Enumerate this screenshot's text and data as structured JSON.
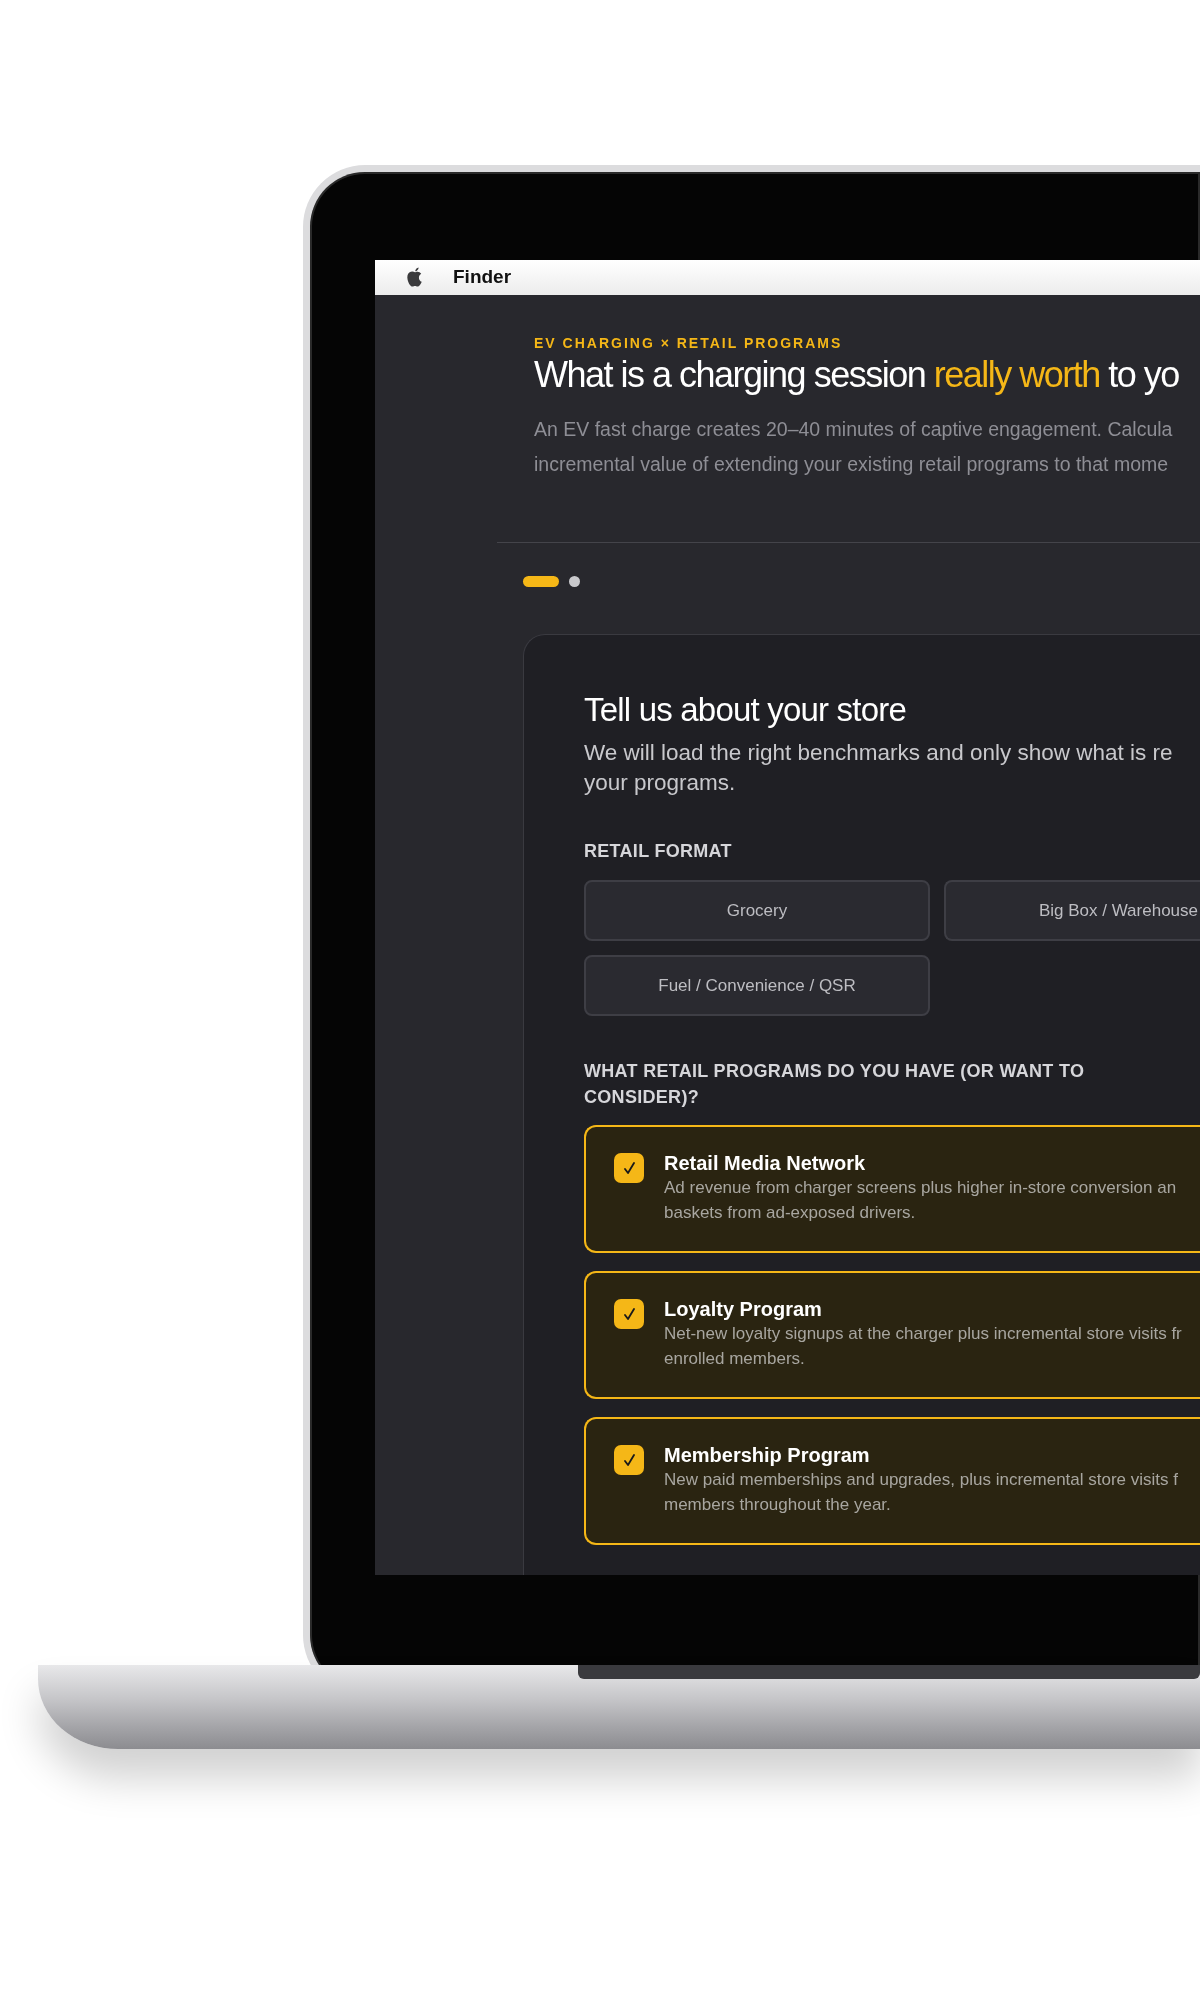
{
  "menu_bar": {
    "app_name": "Finder"
  },
  "hero": {
    "eyebrow": "EV CHARGING × RETAIL PROGRAMS",
    "heading": [
      {
        "text": "What is a charging session ",
        "highlight": false
      },
      {
        "text": "really worth",
        "highlight": true
      },
      {
        "text": " to yo",
        "highlight": false
      }
    ],
    "intro_lines": [
      "An EV fast charge creates 20–40 minutes of captive engagement. Calcula",
      "incremental value of extending your existing retail programs to that mome"
    ]
  },
  "steps": [
    {
      "selected": true
    },
    {
      "selected": false
    }
  ],
  "store_card": {
    "title": "Tell us about your store",
    "subtitle_lines": [
      "We will load the right benchmarks and only show what is re",
      "your programs."
    ],
    "format_label": "RETAIL FORMAT",
    "formats": [
      {
        "label": "Grocery",
        "selected": false
      },
      {
        "label": "Big Box / Warehouse",
        "selected": false
      },
      {
        "label": "Fuel / Convenience / QSR",
        "selected": false
      }
    ],
    "programs_label": "WHAT RETAIL PROGRAMS DO YOU HAVE (OR WANT TO CONSIDER)?",
    "programs": [
      {
        "title": "Retail Media Network",
        "description_lines": [
          "Ad revenue from charger screens plus higher in-store conversion an",
          "baskets from ad-exposed drivers."
        ],
        "checked": true
      },
      {
        "title": "Loyalty Program",
        "description_lines": [
          "Net-new loyalty signups at the charger plus incremental store visits fr",
          "enrolled members."
        ],
        "checked": true
      },
      {
        "title": "Membership Program",
        "description_lines": [
          "New paid memberships and upgrades, plus incremental store visits f",
          "members throughout the year."
        ],
        "checked": true
      }
    ]
  }
}
